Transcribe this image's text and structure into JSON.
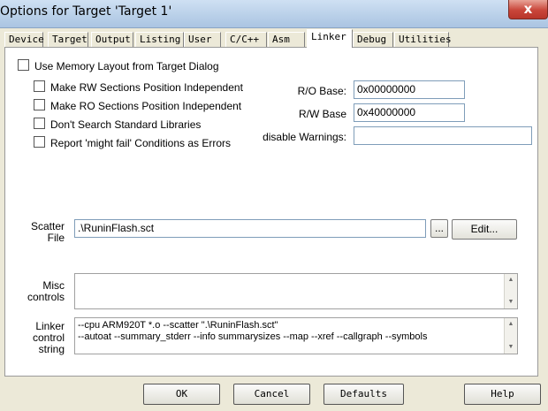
{
  "window": {
    "title": "Options for Target 'Target 1'",
    "close_glyph": "x"
  },
  "tabs": [
    {
      "label": "Device"
    },
    {
      "label": "Target"
    },
    {
      "label": "Output"
    },
    {
      "label": "Listing"
    },
    {
      "label": "User"
    },
    {
      "label": "C/C++"
    },
    {
      "label": "Asm"
    },
    {
      "label": "Linker"
    },
    {
      "label": "Debug"
    },
    {
      "label": "Utilities"
    }
  ],
  "active_tab": "Linker",
  "options": {
    "use_memory_layout": {
      "label": "Use Memory Layout from Target Dialog",
      "checked": false
    },
    "rw_position_independent": {
      "label": "Make RW Sections Position Independent",
      "checked": false
    },
    "ro_position_independent": {
      "label": "Make RO Sections Position Independent",
      "checked": false
    },
    "dont_search_std_libs": {
      "label": "Don't Search Standard Libraries",
      "checked": false
    },
    "report_might_fail": {
      "label": "Report 'might fail' Conditions as Errors",
      "checked": false
    }
  },
  "fields": {
    "ro_base": {
      "label": "R/O Base:",
      "value": "0x00000000"
    },
    "rw_base": {
      "label": "R/W Base",
      "value": "0x40000000"
    },
    "disable_warnings": {
      "label": "disable Warnings:",
      "value": ""
    }
  },
  "scatter": {
    "label_line1": "Scatter",
    "label_line2": "File",
    "value": ".\\RuninFlash.sct",
    "browse_label": "...",
    "edit_label": "Edit..."
  },
  "misc": {
    "label_line1": "Misc",
    "label_line2": "controls",
    "value": ""
  },
  "linker_string": {
    "label_line1": "Linker",
    "label_line2": "control",
    "label_line3": "string",
    "lines": [
      "--cpu ARM920T *.o --scatter \".\\RuninFlash.sct\"",
      "--autoat --summary_stderr --info summarysizes --map --xref --callgraph --symbols"
    ]
  },
  "dialog_buttons": {
    "ok": "OK",
    "cancel": "Cancel",
    "defaults": "Defaults",
    "help": "Help"
  }
}
